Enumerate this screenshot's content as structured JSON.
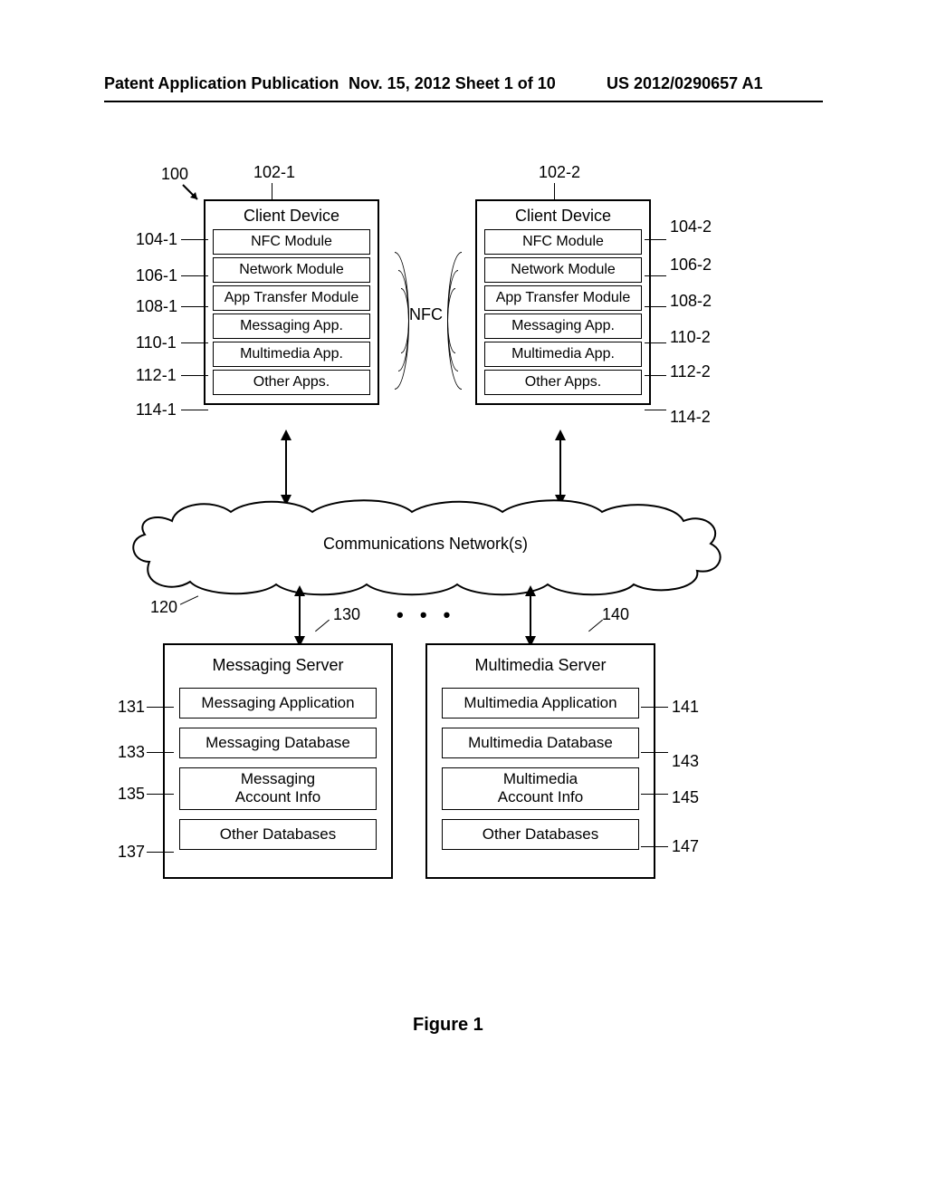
{
  "header": {
    "left": "Patent Application Publication",
    "mid": "Nov. 15, 2012  Sheet 1 of 10",
    "right": "US 2012/0290657 A1"
  },
  "refs": {
    "r100": "100",
    "r102_1": "102-1",
    "r102_2": "102-2",
    "r104_1": "104-1",
    "r104_2": "104-2",
    "r106_1": "106-1",
    "r106_2": "106-2",
    "r108_1": "108-1",
    "r108_2": "108-2",
    "r110_1": "110-1",
    "r110_2": "110-2",
    "r112_1": "112-1",
    "r112_2": "112-2",
    "r114_1": "114-1",
    "r114_2": "114-2",
    "r120": "120",
    "r130": "130",
    "r131": "131",
    "r133": "133",
    "r135": "135",
    "r137": "137",
    "r140": "140",
    "r141": "141",
    "r143": "143",
    "r145": "145",
    "r147": "147"
  },
  "device1": {
    "title": "Client Device",
    "m1": "NFC Module",
    "m2": "Network Module",
    "m3": "App Transfer Module",
    "m4": "Messaging App.",
    "m5": "Multimedia App.",
    "m6": "Other Apps."
  },
  "device2": {
    "title": "Client Device",
    "m1": "NFC Module",
    "m2": "Network Module",
    "m3": "App Transfer Module",
    "m4": "Messaging App.",
    "m5": "Multimedia App.",
    "m6": "Other Apps."
  },
  "nfc": "NFC",
  "cloud": "Communications Network(s)",
  "dots": "• • •",
  "server1": {
    "title": "Messaging Server",
    "m1": "Messaging Application",
    "m2": "Messaging Database",
    "m3a": "Messaging",
    "m3b": "Account Info",
    "m4": "Other Databases"
  },
  "server2": {
    "title": "Multimedia Server",
    "m1": "Multimedia Application",
    "m2": "Multimedia Database",
    "m3a": "Multimedia",
    "m3b": "Account Info",
    "m4": "Other Databases"
  },
  "figcap": "Figure 1"
}
